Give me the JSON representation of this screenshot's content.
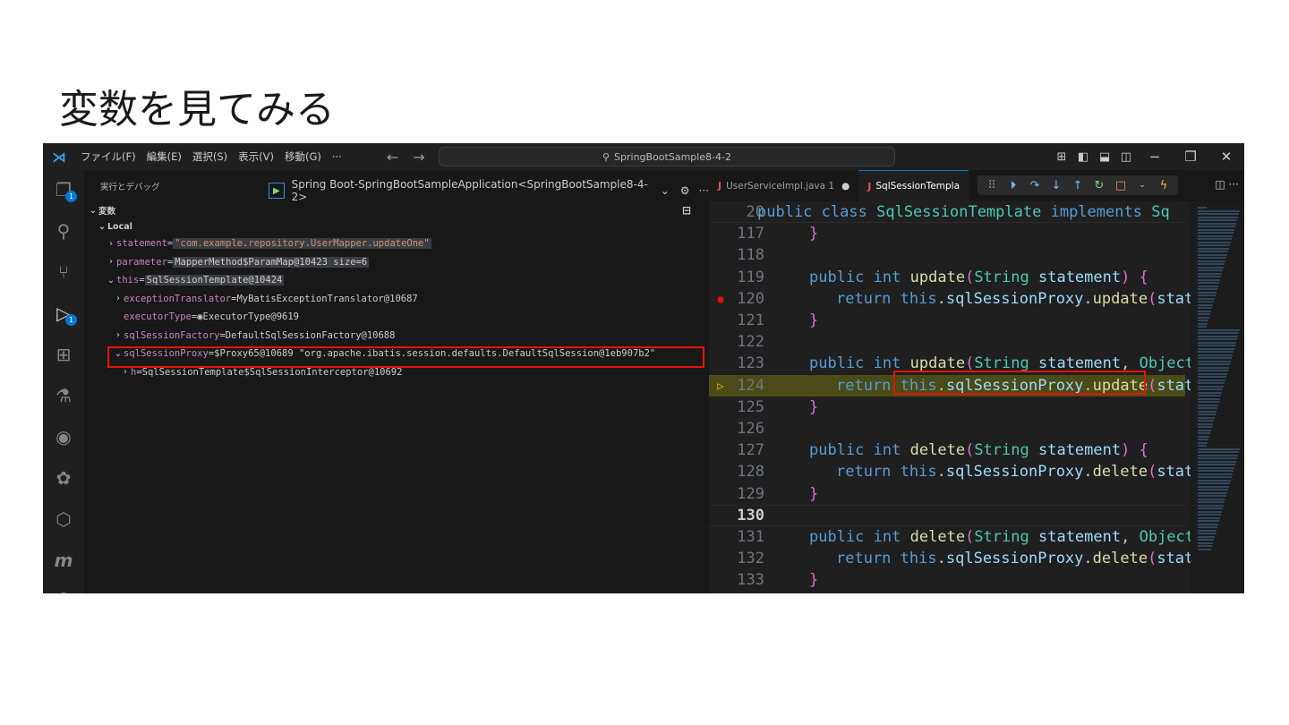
{
  "slide": {
    "title": "変数を見てみる"
  },
  "titlebar": {
    "menu": [
      "ファイル(F)",
      "編集(E)",
      "選択(S)",
      "表示(V)",
      "移動(G)",
      "···"
    ],
    "back_icon": "arrow-left-icon",
    "forward_icon": "arrow-right-icon",
    "search_text": "SpringBootSample8-4-2"
  },
  "activity_badges": {
    "explorer": "1",
    "debug": "1"
  },
  "debug_panel": {
    "header": "実行とデバッグ",
    "launch_config": "Spring Boot-SpringBootSampleApplication<SpringBootSample8-4-2>",
    "variables_section": "変数",
    "local_scope": "Local",
    "variables": [
      {
        "indent": 1,
        "twisty": "›",
        "name": "statement",
        "value": "\"com.example.repository.UserMapper.updateOne\"",
        "highlight": true,
        "string": true
      },
      {
        "indent": 1,
        "twisty": "›",
        "name": "parameter",
        "value": "MapperMethod$ParamMap@10423 size=6",
        "highlight": true,
        "string": false
      },
      {
        "indent": 1,
        "twisty": "⌄",
        "name": "this",
        "value": "SqlSessionTemplate@10424",
        "highlight": true,
        "string": false
      },
      {
        "indent": 2,
        "twisty": "›",
        "name": "exceptionTranslator",
        "value": "MyBatisExceptionTranslator@10687",
        "highlight": false,
        "string": false
      },
      {
        "indent": 2,
        "twisty": "",
        "name": "executorType",
        "value": "ExecutorType@9619",
        "highlight": false,
        "string": false,
        "eye": true
      },
      {
        "indent": 2,
        "twisty": "›",
        "name": "sqlSessionFactory",
        "value": "DefaultSqlSessionFactory@10688",
        "highlight": false,
        "string": false
      },
      {
        "indent": 2,
        "twisty": "⌄",
        "name": "sqlSessionProxy",
        "value": "$Proxy65@10689 \"org.apache.ibatis.session.defaults.DefaultSqlSession@1eb907b2\"",
        "highlight": false,
        "string": false
      },
      {
        "indent": 3,
        "twisty": "›",
        "name": "h",
        "value": "SqlSessionTemplate$SqlSessionInterceptor@10692",
        "highlight": false,
        "string": false
      }
    ]
  },
  "editor": {
    "tabs": [
      {
        "label": "UserServiceImpl.java 1",
        "active": false,
        "dirty": true
      },
      {
        "label": "SqlSessionTempla",
        "active": true,
        "dirty": false
      }
    ],
    "lines": [
      {
        "num": "20",
        "text": "public class SqlSessionTemplate implements Sq",
        "sticky": true
      },
      {
        "num": "117",
        "text": "}"
      },
      {
        "num": "118",
        "text": ""
      },
      {
        "num": "119",
        "text": "public int update(String statement) {"
      },
      {
        "num": "120",
        "text": "return this.sqlSessionProxy.update(state",
        "breakpoint": true
      },
      {
        "num": "121",
        "text": "}"
      },
      {
        "num": "122",
        "text": ""
      },
      {
        "num": "123",
        "text": "public int update(String statement, Object"
      },
      {
        "num": "124",
        "text": "return this.sqlSessionProxy.update(state",
        "exec": true
      },
      {
        "num": "125",
        "text": "}"
      },
      {
        "num": "126",
        "text": ""
      },
      {
        "num": "127",
        "text": "public int delete(String statement) {"
      },
      {
        "num": "128",
        "text": "return this.sqlSessionProxy.delete(state"
      },
      {
        "num": "129",
        "text": "}"
      },
      {
        "num": "130",
        "text": "",
        "current": true
      },
      {
        "num": "131",
        "text": "public int delete(String statement, Object"
      },
      {
        "num": "132",
        "text": "return this.sqlSessionProxy.delete(state"
      },
      {
        "num": "133",
        "text": "}"
      }
    ]
  }
}
